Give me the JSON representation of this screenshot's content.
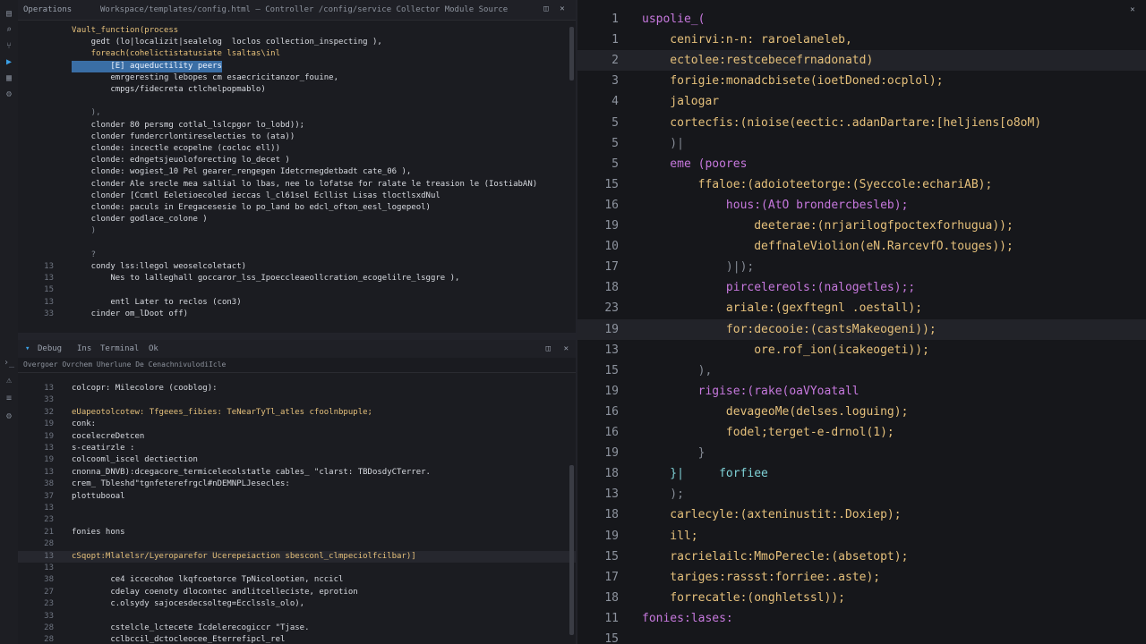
{
  "top_pane": {
    "title": "Operations",
    "path": "Workspace/templates/config.html  —  Controller  /config/service  Collector  Module  Source",
    "lines": [
      {
        "n": "",
        "t": "Vault_function(process",
        "c": "c-yel"
      },
      {
        "n": "",
        "t": "    gedt (lo|localizit|sealelog  loclos collection_inspecting ),",
        "c": "c-wht"
      },
      {
        "n": "",
        "t": "    foreach(cohelictistatusiate lsaltas\\inl",
        "c": "c-yel"
      },
      {
        "n": "",
        "t": "        [E] aqueductility peers",
        "c": "sel"
      },
      {
        "n": "",
        "t": "        emrgeresting lebopes cm esaecricitanzor_fouine,",
        "c": "c-wht"
      },
      {
        "n": "",
        "t": "        cmpgs/fidecreta ctlchelpopmablo)",
        "c": "c-wht"
      },
      {
        "n": "",
        "t": "",
        "c": ""
      },
      {
        "n": "",
        "t": "    ),",
        "c": "c-dim"
      },
      {
        "n": "",
        "t": "    clonder 80 persmg cotlal_lslcpgor lo_lobd));",
        "c": "c-wht"
      },
      {
        "n": "",
        "t": "    clonder fundercrlontireselecties to (ata))",
        "c": "c-wht"
      },
      {
        "n": "",
        "t": "    clonde: incectle ecopelne (cocloc ell))",
        "c": "c-wht"
      },
      {
        "n": "",
        "t": "    clonde: edngetsjeuoloforecting lo_decet )",
        "c": "c-wht"
      },
      {
        "n": "",
        "t": "    clonde: wogiest_10 Pel gearer_rengegen Idetcrnegdetbadt cate_06 ),",
        "c": "c-wht"
      },
      {
        "n": "",
        "t": "    clonder Ale srecle mea sallial lo lbas, nee lo lofatse for ralate le treasion le (IostiabAN)",
        "c": "c-wht"
      },
      {
        "n": "",
        "t": "    clonder [Ccmtl Eeletioecoled ieccas l_cl61sel Ecllist Lisas tloctlsxdNul",
        "c": "c-wht"
      },
      {
        "n": "",
        "t": "    clonde: paculs in Eregacesesie lo po_land bo edcl_ofton_eesl_logepeol)",
        "c": "c-wht"
      },
      {
        "n": "",
        "t": "    clonder godlace_colone )",
        "c": "c-wht"
      },
      {
        "n": "",
        "t": "    )",
        "c": "c-dim"
      },
      {
        "n": "",
        "t": "",
        "c": ""
      },
      {
        "n": "",
        "t": "    ?",
        "c": "c-dim"
      },
      {
        "n": "13",
        "t": "    condy lss:llegol weoselcoletact)",
        "c": "c-wht"
      },
      {
        "n": "13",
        "t": "        Nes to lalleghall goccaror_lss_Ipoeccleaeollcration_ecogelilre_lsggre ),",
        "c": "c-wht"
      },
      {
        "n": "15",
        "t": "",
        "c": ""
      },
      {
        "n": "13",
        "t": "        entl Later to reclos (con3)",
        "c": "c-wht"
      },
      {
        "n": "33",
        "t": "    cinder om_lDoot off)",
        "c": "c-wht"
      }
    ]
  },
  "bottom_pane": {
    "tabs": [
      "Debug",
      "Ins",
      "Terminal",
      "Ok"
    ],
    "path": "Overgoer Ovrchem Uherlune De CenachnivulodiIcle",
    "lines": [
      {
        "n": "13",
        "t": "colcopr: Milecolore (cooblog):",
        "c": "c-wht",
        "hl": false
      },
      {
        "n": "33",
        "t": "",
        "c": "",
        "hl": false
      },
      {
        "n": "32",
        "t": "eUapeotolcotew: Tfgeees_fibies: TeNearTyTl_atles cfoolnbpuple;",
        "c": "c-yel",
        "hl": false
      },
      {
        "n": "19",
        "t": "conk:",
        "c": "c-wht",
        "hl": false
      },
      {
        "n": "19",
        "t": "cocelecreDetcen",
        "c": "c-wht",
        "hl": false
      },
      {
        "n": "13",
        "t": "s-ceatirzle :",
        "c": "c-wht",
        "hl": false
      },
      {
        "n": "19",
        "t": "colcooml_iscel dectiection",
        "c": "c-wht",
        "hl": false
      },
      {
        "n": "13",
        "t": "cnonna_DNVB):dcegacore_termicelecolstatle cables_ \"clarst: TBDosdyCTerrer.",
        "c": "c-wht",
        "hl": false
      },
      {
        "n": "38",
        "t": "crem_ Tbleshd\"tgnfeterefrgcl#nDEMNPLJesecles:",
        "c": "c-wht",
        "hl": false
      },
      {
        "n": "37",
        "t": "plottubooal",
        "c": "c-wht",
        "hl": false
      },
      {
        "n": "13",
        "t": "",
        "c": "",
        "hl": false
      },
      {
        "n": "23",
        "t": "",
        "c": "",
        "hl": false
      },
      {
        "n": "21",
        "t": "fonies hons",
        "c": "c-wht",
        "hl": false
      },
      {
        "n": "28",
        "t": "",
        "c": "",
        "hl": false
      },
      {
        "n": "13",
        "t": "cSqopt:Mlalelsr/Lyeroparefor Ucerepeiaction sbesconl_clmpeciolfcilbar)]",
        "c": "c-yel",
        "hl": true
      },
      {
        "n": "13",
        "t": "",
        "c": "",
        "hl": false
      },
      {
        "n": "38",
        "t": "        ce4 iccecohoe lkqfcoetorce TpNicolootien, nccicl",
        "c": "c-wht",
        "hl": false
      },
      {
        "n": "27",
        "t": "        cdelay coenoty dlocontec andlitcelleciste, eprotion",
        "c": "c-wht",
        "hl": false
      },
      {
        "n": "23",
        "t": "        c.olsydy sajocesdecsolteg=Ecclssls_olo),",
        "c": "c-wht",
        "hl": false
      },
      {
        "n": "33",
        "t": "",
        "c": "",
        "hl": false
      },
      {
        "n": "28",
        "t": "        cstelcle_lctecete Icdelerecogiccr \"Tjase.",
        "c": "c-wht",
        "hl": false
      },
      {
        "n": "28",
        "t": "        cclbccil_dctocleocee_Eterrefipcl_rel",
        "c": "c-wht",
        "hl": false
      }
    ]
  },
  "right_pane": {
    "lines": [
      {
        "n": "1",
        "t": "uspolie_(",
        "c": "c-mag",
        "hl": false
      },
      {
        "n": "1",
        "t": "    cenirvi:n-n: raroelaneleb,",
        "c": "c-yel",
        "hl": false
      },
      {
        "n": "2",
        "t": "    ectolee:restcebecefrnadonatd)",
        "c": "c-yel",
        "hl": true
      },
      {
        "n": "3",
        "t": "    forigie:monadcbisete(ioetDoned:ocplol);",
        "c": "c-yel",
        "hl": false
      },
      {
        "n": "4",
        "t": "    jalogar",
        "c": "c-yel",
        "hl": false
      },
      {
        "n": "5",
        "t": "    cortecfis:(nioise(eectic:.adanDartare:[heljiens[o8oM)",
        "c": "c-yel",
        "hl": false
      },
      {
        "n": "5",
        "t": "    )|",
        "c": "c-dim",
        "hl": false
      },
      {
        "n": "5",
        "t": "    eme (poores",
        "c": "c-mag",
        "hl": false
      },
      {
        "n": "15",
        "t": "        ffaloe:(adoioteetorge:(Syeccole:echariAB);",
        "c": "c-yel",
        "hl": false
      },
      {
        "n": "16",
        "t": "            hous:(AtO brondercbesleb);",
        "c": "c-mag",
        "hl": false
      },
      {
        "n": "19",
        "t": "                deeterae:(nrjarilogfpoctexforhugua));",
        "c": "c-yel",
        "hl": false
      },
      {
        "n": "10",
        "t": "                deffnaleViolion(eN.RarcevfO.touges));",
        "c": "c-yel",
        "hl": false
      },
      {
        "n": "17",
        "t": "            )|);",
        "c": "c-dim",
        "hl": false
      },
      {
        "n": "18",
        "t": "            pircelereols:(nalogetles);;",
        "c": "c-mag",
        "hl": false
      },
      {
        "n": "23",
        "t": "            ariale:(gexftegnl .oestall);",
        "c": "c-yel",
        "hl": false
      },
      {
        "n": "19",
        "t": "            for:decooie:(castsMakeogeni));",
        "c": "c-yel",
        "hl": true
      },
      {
        "n": "13",
        "t": "                ore.rof_ion(icakeogeti));",
        "c": "c-yel",
        "hl": false
      },
      {
        "n": "15",
        "t": "        ),",
        "c": "c-dim",
        "hl": false
      },
      {
        "n": "19",
        "t": "        rigise:(rake(oaVYoatall",
        "c": "c-mag",
        "hl": false
      },
      {
        "n": "16",
        "t": "            devageoMe(delses.loguing);",
        "c": "c-yel",
        "hl": false
      },
      {
        "n": "16",
        "t": "            fodel;terget-e-drnol(1);",
        "c": "c-yel",
        "hl": false
      },
      {
        "n": "19",
        "t": "        }",
        "c": "c-dim",
        "hl": false
      },
      {
        "n": "18",
        "t": "    }|     forfiee",
        "c": "c-cyan",
        "hl": false
      },
      {
        "n": "13",
        "t": "    );",
        "c": "c-dim",
        "hl": false
      },
      {
        "n": "18",
        "t": "    carlecyle:(axteninustit:.Doxiep);",
        "c": "c-yel",
        "hl": false
      },
      {
        "n": "19",
        "t": "    ill;",
        "c": "c-yel",
        "hl": false
      },
      {
        "n": "15",
        "t": "    racrielailc:MmoPerecle:(absetopt);",
        "c": "c-yel",
        "hl": false
      },
      {
        "n": "17",
        "t": "    tariges:rassst:forriee:.aste);",
        "c": "c-yel",
        "hl": false
      },
      {
        "n": "18",
        "t": "    forrecatle:(onghletssl));",
        "c": "c-yel",
        "hl": false
      },
      {
        "n": "11",
        "t": "fonies:lases:",
        "c": "c-mag",
        "hl": false
      },
      {
        "n": "15",
        "t": "",
        "c": "",
        "hl": false
      }
    ]
  },
  "icons": [
    "files-icon",
    "search-icon",
    "source-control-icon",
    "run-icon",
    "extensions-icon",
    "debug-icon",
    "settings-icon"
  ]
}
